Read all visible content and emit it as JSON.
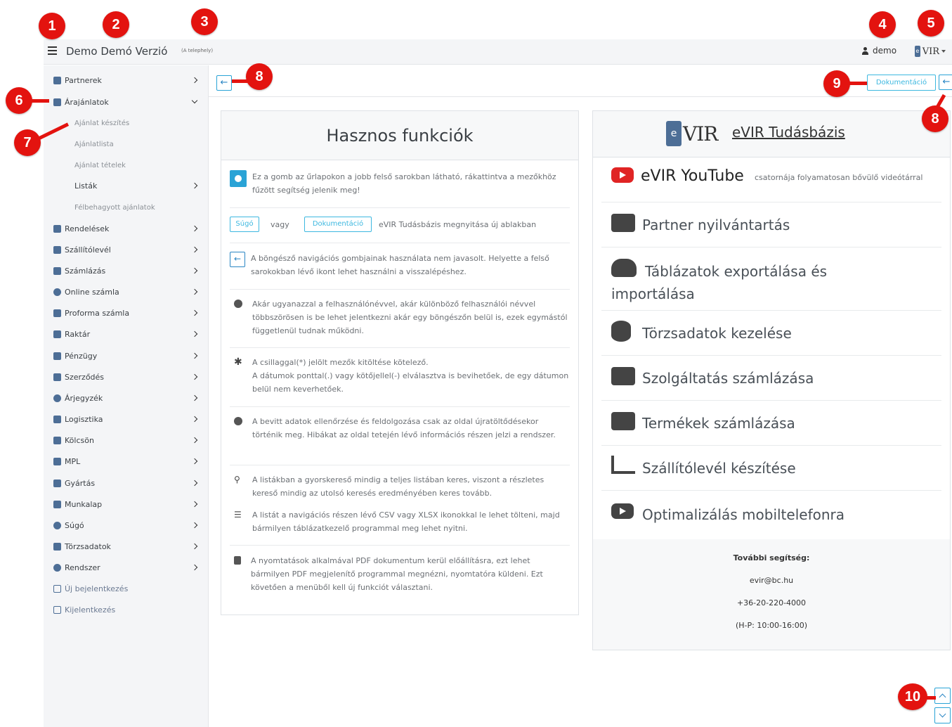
{
  "topbar": {
    "title": "Demo Demó Verzió",
    "site": "(A telephely)",
    "user": "demo",
    "logo_text": "VIR",
    "logo_badge": "e"
  },
  "sidebar": {
    "items": [
      {
        "label": "Partnerek"
      },
      {
        "label": "Árajánlatok"
      },
      {
        "label": "Rendelések"
      },
      {
        "label": "Szállítólevél"
      },
      {
        "label": "Számlázás"
      },
      {
        "label": "Online számla"
      },
      {
        "label": "Proforma számla"
      },
      {
        "label": "Raktár"
      },
      {
        "label": "Pénzügy"
      },
      {
        "label": "Szerződés"
      },
      {
        "label": "Árjegyzék"
      },
      {
        "label": "Logisztika"
      },
      {
        "label": "Kölcsön"
      },
      {
        "label": "MPL"
      },
      {
        "label": "Gyártás"
      },
      {
        "label": "Munkalap"
      },
      {
        "label": "Súgó"
      },
      {
        "label": "Törzsadatok"
      },
      {
        "label": "Rendszer"
      },
      {
        "label": "Új bejelentkezés"
      },
      {
        "label": "Kijelentkezés"
      }
    ],
    "subitems": [
      {
        "label": "Ajánlat készítés"
      },
      {
        "label": "Ajánlatlista"
      },
      {
        "label": "Ajánlat tételek"
      },
      {
        "label": "Listák"
      },
      {
        "label": "Félbehagyott ajánlatok"
      }
    ]
  },
  "content": {
    "back_label": "←",
    "doc_button": "Dokumentáció"
  },
  "left_card": {
    "title": "Hasznos funkciók",
    "tips": [
      "Ez a gomb az űrlapokon a jobb felső sarokban látható, rákattintva a mezőkhöz fűzött segítség jelenik meg!",
      "eVIR Tudásbázis megnyitása új ablakban",
      "A böngésző navigációs gombjainak használata nem javasolt. Helyette a felső sarokokban lévő ikont lehet használni a visszalépéshez.",
      "Akár ugyanazzal a felhasználónévvel, akár különböző felhasználói névvel többszörösen is be lehet jelentkezni akár egy böngészőn belül is, ezek egymástól függetlenül tudnak működni.",
      "A csillaggal(*) jelölt mezők kitöltése kötelező.",
      "A dátumok ponttal(.) vagy kötőjellel(-) elválasztva is bevihetőek, de egy dátumon belül nem keverhetőek.",
      "A bevitt adatok ellenőrzése és feldolgozása csak az oldal újratöltődésekor történik meg. Hibákat az oldal tetején lévő információs részen jelzi a rendszer.",
      "A listákban a gyorskereső mindig a teljes listában keres, viszont a részletes kereső mindig az utolsó keresés eredményében keres tovább.",
      "A listát a navigációs részen lévő CSV vagy XLSX ikonokkal le lehet tölteni, majd bármilyen táblázatkezelő programmal meg lehet nyitni.",
      "A nyomtatások alkalmával PDF dokumentum kerül előállításra, ezt lehet bármilyen PDF megjelenítő programmal megnézni, nyomtatóra küldeni. Ezt követően a menüből kell új funkciót választani."
    ],
    "sugo_btn": "Súgó",
    "vagy": "vagy",
    "doc_btn": "Dokumentáció"
  },
  "right_card": {
    "title": "eVIR Tudásbázis",
    "logo_text": "VIR",
    "logo_badge": "e",
    "youtube_title": "eVIR YouTube",
    "youtube_sub": "csatornája folyamatosan bővülő videótárral",
    "items": [
      "Partner nyilvántartás",
      "Táblázatok exportálása és importálása",
      "Törzsadatok kezelése",
      "Szolgáltatás számlázása",
      "Termékek számlázása",
      "Szállítólevél készítése",
      "Optimalizálás mobiltelefonra"
    ],
    "help": {
      "heading": "További segítség:",
      "email": "evir@bc.hu",
      "phone": "+36-20-220-4000",
      "hours": "(H-P: 10:00-16:00)"
    }
  },
  "callouts": [
    "1",
    "2",
    "3",
    "4",
    "5",
    "6",
    "7",
    "8",
    "8",
    "9",
    "10"
  ],
  "colors": {
    "callout": "#e3130f",
    "accent": "#3db8e0",
    "brand": "#4d6e96"
  }
}
